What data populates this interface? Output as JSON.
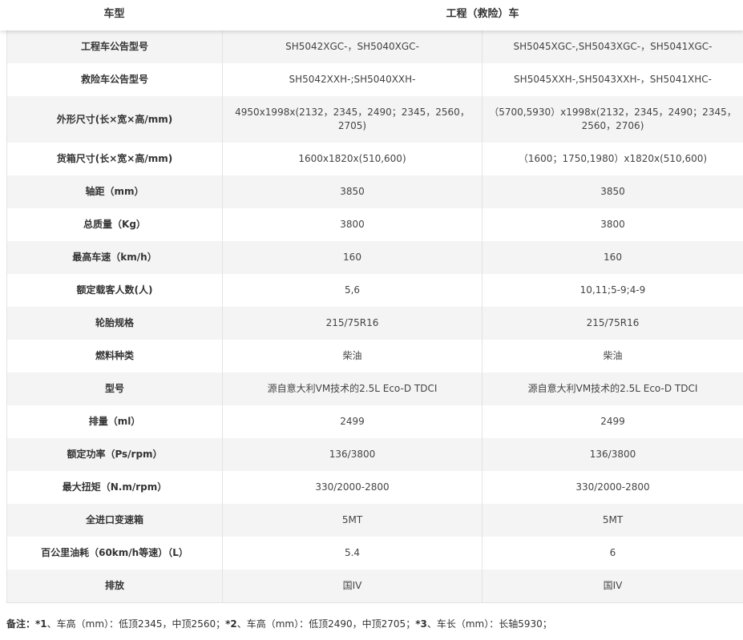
{
  "header": {
    "col1": "车型",
    "col2": "工程（救险）车"
  },
  "rows": [
    {
      "label": "工程车公告型号",
      "v1": "SH5042XGC-，SH5040XGC-",
      "v2": "SH5045XGC-,SH5043XGC-，SH5041XGC-"
    },
    {
      "label": "救险车公告型号",
      "v1": "SH5042XXH-;SH5040XXH-",
      "v2": "SH5045XXH-,SH5043XXH-，SH5041XHC-"
    },
    {
      "label": "外形尺寸(长×宽×高/mm)",
      "v1": "4950x1998x(2132，2345，2490；2345，2560，2705)",
      "v2": "（5700,5930）x1998x(2132，2345，2490；2345，2560，2706)"
    },
    {
      "label": "货箱尺寸(长×宽×高/mm)",
      "v1": "1600x1820x(510,600)",
      "v2": "（1600；1750,1980）x1820x(510,600)"
    },
    {
      "label": "轴距（mm）",
      "v1": "3850",
      "v2": "3850"
    },
    {
      "label": "总质量（Kg）",
      "v1": "3800",
      "v2": "3800"
    },
    {
      "label": "最高车速（km/h）",
      "v1": "160",
      "v2": "160"
    },
    {
      "label": "额定载客人数(人)",
      "v1": "5,6",
      "v2": "10,11;5-9;4-9"
    },
    {
      "label": "轮胎规格",
      "v1": "215/75R16",
      "v2": "215/75R16"
    },
    {
      "label": "燃料种类",
      "v1": "柴油",
      "v2": "柴油"
    },
    {
      "label": "型号",
      "v1": "源自意大利VM技术的2.5L Eco-D TDCI",
      "v2": "源自意大利VM技术的2.5L Eco-D TDCI"
    },
    {
      "label": "排量（ml）",
      "v1": "2499",
      "v2": "2499"
    },
    {
      "label": "额定功率（Ps/rpm）",
      "v1": "136/3800",
      "v2": "136/3800"
    },
    {
      "label": "最大扭矩（N.m/rpm）",
      "v1": "330/2000-2800",
      "v2": "330/2000-2800"
    },
    {
      "label": "全进口变速箱",
      "v1": "5MT",
      "v2": "5MT"
    },
    {
      "label": "百公里油耗（60km/h等速）（L）",
      "v1": "5.4",
      "v2": "6"
    },
    {
      "label": "排放",
      "v1": "国IV",
      "v2": "国IV"
    }
  ],
  "note": {
    "prefix": "备注：",
    "m1": "*1",
    "t1": "、车高（mm）：低顶2345，中顶2560；",
    "m2": "*2",
    "t2": "、车高（mm）：低顶2490，中顶2705；",
    "m3": "*3",
    "t3": "、车长（mm）：长轴5930；"
  }
}
